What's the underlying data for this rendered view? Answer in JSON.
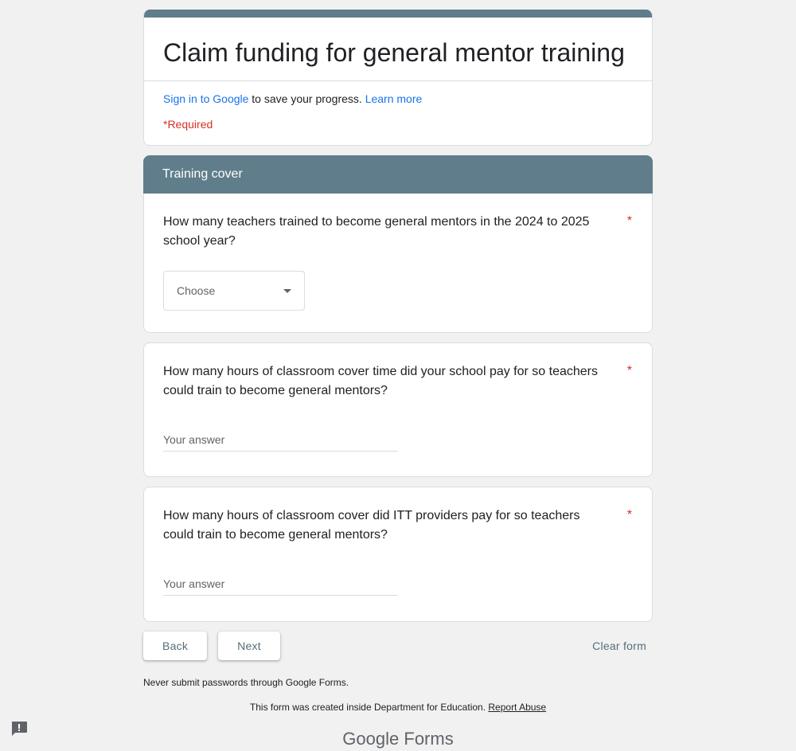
{
  "form": {
    "title": "Claim funding for general mentor training",
    "signin_link": "Sign in to Google",
    "signin_text": " to save your progress. ",
    "learn_more": "Learn more",
    "required_note": "*Required"
  },
  "section": {
    "title": "Training cover"
  },
  "questions": [
    {
      "text": "How many teachers trained to become general mentors in the 2024 to 2025 school year?",
      "required_mark": "*",
      "dropdown_value": "Choose"
    },
    {
      "text": "How many hours of classroom cover time did your school pay for so teachers could train to become general mentors?",
      "required_mark": "*",
      "placeholder": "Your answer"
    },
    {
      "text": "How many hours of classroom cover did ITT providers pay for so teachers could train to become general mentors?",
      "required_mark": "*",
      "placeholder": "Your answer"
    }
  ],
  "nav": {
    "back": "Back",
    "next": "Next",
    "clear": "Clear form"
  },
  "footer": {
    "password_note": "Never submit passwords through Google Forms.",
    "created_note": "This form was created inside Department for Education. ",
    "report_abuse": "Report Abuse",
    "logo_google": "Google",
    "logo_forms": "Forms"
  },
  "icons": {
    "feedback": "report-feedback-icon",
    "dropdown_caret": "caret-down-icon"
  },
  "colors": {
    "accent": "#607d8b",
    "link": "#1a73e8",
    "required": "#d93025",
    "background": "#f1f1f1"
  }
}
